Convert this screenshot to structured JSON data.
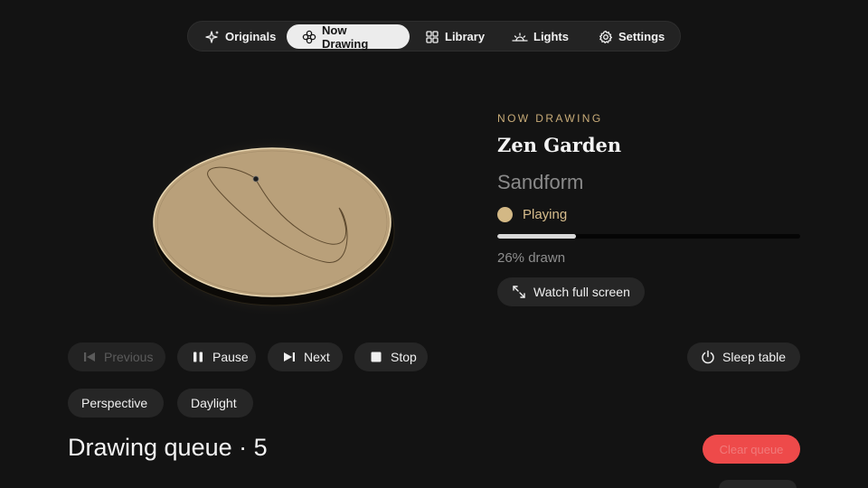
{
  "nav": {
    "items": [
      {
        "label": "Originals",
        "icon": "sparkle-icon"
      },
      {
        "label": "Now Drawing",
        "icon": "knot-icon",
        "active": true
      },
      {
        "label": "Library",
        "icon": "grid-icon"
      },
      {
        "label": "Lights",
        "icon": "sunrise-icon"
      },
      {
        "label": "Settings",
        "icon": "gear-icon"
      }
    ]
  },
  "now_playing": {
    "eyebrow": "NOW DRAWING",
    "title": "Zen Garden",
    "artist": "Sandform",
    "status": "Playing",
    "progress_fraction": 0.26,
    "progress_text": "26% drawn",
    "watch_label": "Watch full screen"
  },
  "controls": {
    "previous": "Previous",
    "pause": "Pause",
    "next": "Next",
    "stop": "Stop",
    "sleep": "Sleep table",
    "perspective": "Perspective",
    "daylight": "Daylight"
  },
  "queue": {
    "title": "Drawing queue · 5",
    "clear_label": "Clear queue"
  },
  "colors": {
    "background": "#131313",
    "accent_sand": "#c9ac78",
    "danger": "#ee4a4a"
  }
}
